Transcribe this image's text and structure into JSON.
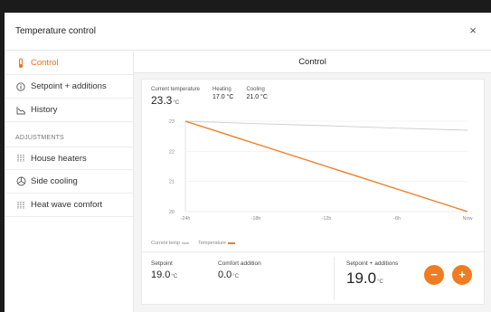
{
  "window": {
    "title": "Temperature control",
    "close_icon": "×"
  },
  "sidebar": {
    "items": [
      {
        "label": "Control",
        "icon": "thermometer-icon",
        "active": true
      },
      {
        "label": "Setpoint + additions",
        "icon": "info-icon"
      },
      {
        "label": "History",
        "icon": "chart-icon"
      }
    ],
    "section_label": "ADJUSTMENTS",
    "adjustments": [
      {
        "label": "House heaters",
        "icon": "heater-icon"
      },
      {
        "label": "Side cooling",
        "icon": "fan-icon"
      },
      {
        "label": "Heat wave comfort",
        "icon": "heater-icon"
      }
    ]
  },
  "main": {
    "title": "Control",
    "current": {
      "label": "Current temperature",
      "value": "23.3",
      "unit": "°C"
    },
    "heating": {
      "label": "Heating",
      "value": "17.0 °C"
    },
    "cooling": {
      "label": "Cooling",
      "value": "21.0 °C"
    },
    "setpoint": {
      "label": "Setpoint",
      "value": "19.0",
      "unit": "°C"
    },
    "comfort": {
      "label": "Comfort addition",
      "value": "0.0",
      "unit": "°C"
    },
    "setpoint_additions": {
      "label": "Setpoint + additions",
      "value": "19.0",
      "unit": "°C"
    },
    "decrease_label": "−",
    "increase_label": "+"
  },
  "chart_data": {
    "type": "line",
    "x": [
      "-24h",
      "-18h",
      "-12h",
      "-6h",
      "Now"
    ],
    "y_ticks": [
      "23",
      "22",
      "21",
      "20"
    ],
    "series": [
      {
        "name": "Temperature",
        "color": "#f07c22",
        "values": [
          23.0,
          22.25,
          21.5,
          20.75,
          20.0
        ]
      },
      {
        "name": "",
        "color": "#cccccc",
        "values": [
          23.0,
          22.92,
          22.85,
          22.77,
          22.7
        ]
      }
    ],
    "legend": [
      "Current temp",
      "Temperature"
    ],
    "ylim": [
      20,
      23
    ]
  },
  "colors": {
    "accent": "#f07c22",
    "text": "#222222"
  }
}
